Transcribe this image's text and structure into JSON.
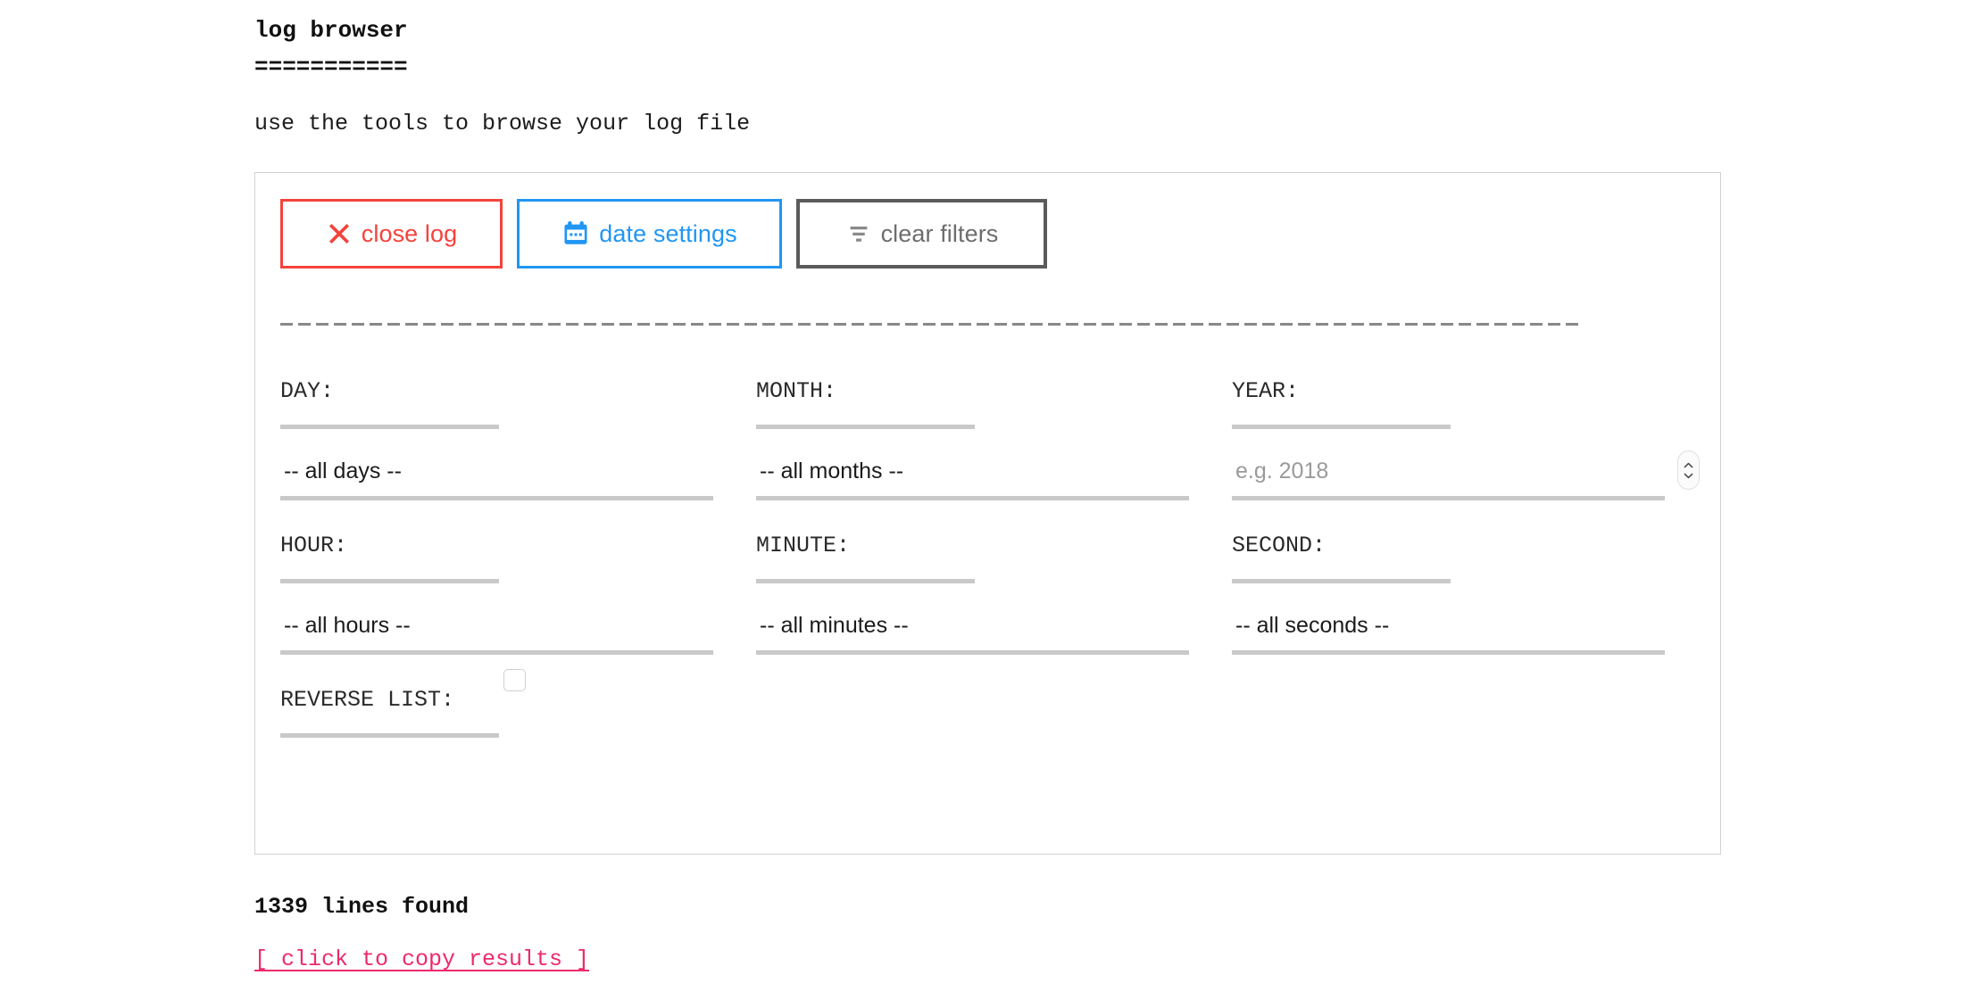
{
  "header": {
    "title": "log browser",
    "title_rule": "===========",
    "subtitle": "use the tools to browse your log file"
  },
  "toolbar": {
    "close_log": {
      "label": "close log",
      "icon": "close-x-icon",
      "color": "#f4433b"
    },
    "date_settings": {
      "label": "date settings",
      "icon": "calendar-icon",
      "color": "#2196f3"
    },
    "clear_filters": {
      "label": "clear filters",
      "icon": "filter-icon",
      "color": "#6d6d6d"
    }
  },
  "filters": {
    "day": {
      "label": "DAY:",
      "value": "-- all days --"
    },
    "month": {
      "label": "MONTH:",
      "value": "-- all months --"
    },
    "year": {
      "label": "YEAR:",
      "value": "",
      "placeholder": "e.g. 2018"
    },
    "hour": {
      "label": "HOUR:",
      "value": "-- all hours --"
    },
    "minute": {
      "label": "MINUTE:",
      "value": "-- all minutes --"
    },
    "second": {
      "label": "SECOND:",
      "value": "-- all seconds --"
    },
    "reverse_list": {
      "label": "REVERSE LIST:",
      "checked": false
    }
  },
  "footer": {
    "lines_found": "1339 lines found",
    "copy_link": "[ click to copy results ]",
    "link_color": "#ec2a6a"
  }
}
